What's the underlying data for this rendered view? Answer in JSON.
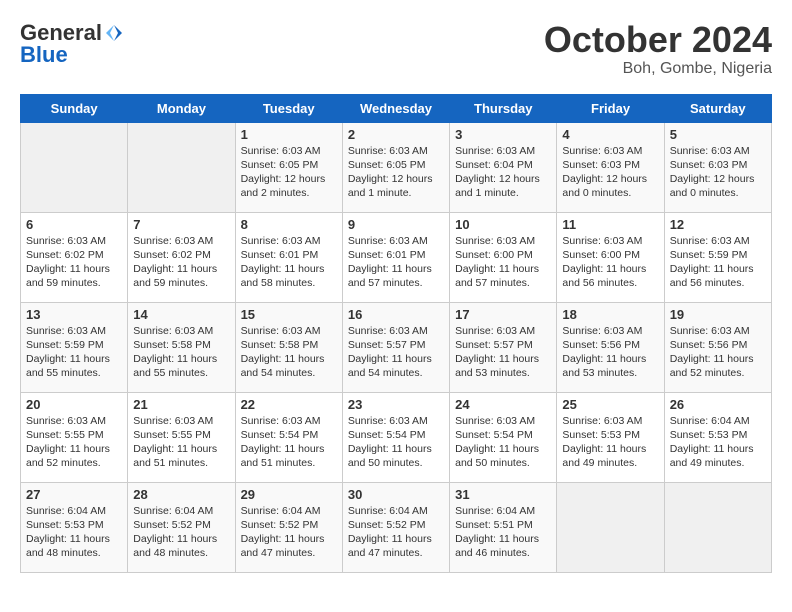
{
  "header": {
    "logo_general": "General",
    "logo_blue": "Blue",
    "month_title": "October 2024",
    "location": "Boh, Gombe, Nigeria"
  },
  "days_of_week": [
    "Sunday",
    "Monday",
    "Tuesday",
    "Wednesday",
    "Thursday",
    "Friday",
    "Saturday"
  ],
  "weeks": [
    [
      {
        "day": "",
        "empty": true
      },
      {
        "day": "",
        "empty": true
      },
      {
        "day": "1",
        "sunrise": "Sunrise: 6:03 AM",
        "sunset": "Sunset: 6:05 PM",
        "daylight": "Daylight: 12 hours and 2 minutes."
      },
      {
        "day": "2",
        "sunrise": "Sunrise: 6:03 AM",
        "sunset": "Sunset: 6:05 PM",
        "daylight": "Daylight: 12 hours and 1 minute."
      },
      {
        "day": "3",
        "sunrise": "Sunrise: 6:03 AM",
        "sunset": "Sunset: 6:04 PM",
        "daylight": "Daylight: 12 hours and 1 minute."
      },
      {
        "day": "4",
        "sunrise": "Sunrise: 6:03 AM",
        "sunset": "Sunset: 6:03 PM",
        "daylight": "Daylight: 12 hours and 0 minutes."
      },
      {
        "day": "5",
        "sunrise": "Sunrise: 6:03 AM",
        "sunset": "Sunset: 6:03 PM",
        "daylight": "Daylight: 12 hours and 0 minutes."
      }
    ],
    [
      {
        "day": "6",
        "sunrise": "Sunrise: 6:03 AM",
        "sunset": "Sunset: 6:02 PM",
        "daylight": "Daylight: 11 hours and 59 minutes."
      },
      {
        "day": "7",
        "sunrise": "Sunrise: 6:03 AM",
        "sunset": "Sunset: 6:02 PM",
        "daylight": "Daylight: 11 hours and 59 minutes."
      },
      {
        "day": "8",
        "sunrise": "Sunrise: 6:03 AM",
        "sunset": "Sunset: 6:01 PM",
        "daylight": "Daylight: 11 hours and 58 minutes."
      },
      {
        "day": "9",
        "sunrise": "Sunrise: 6:03 AM",
        "sunset": "Sunset: 6:01 PM",
        "daylight": "Daylight: 11 hours and 57 minutes."
      },
      {
        "day": "10",
        "sunrise": "Sunrise: 6:03 AM",
        "sunset": "Sunset: 6:00 PM",
        "daylight": "Daylight: 11 hours and 57 minutes."
      },
      {
        "day": "11",
        "sunrise": "Sunrise: 6:03 AM",
        "sunset": "Sunset: 6:00 PM",
        "daylight": "Daylight: 11 hours and 56 minutes."
      },
      {
        "day": "12",
        "sunrise": "Sunrise: 6:03 AM",
        "sunset": "Sunset: 5:59 PM",
        "daylight": "Daylight: 11 hours and 56 minutes."
      }
    ],
    [
      {
        "day": "13",
        "sunrise": "Sunrise: 6:03 AM",
        "sunset": "Sunset: 5:59 PM",
        "daylight": "Daylight: 11 hours and 55 minutes."
      },
      {
        "day": "14",
        "sunrise": "Sunrise: 6:03 AM",
        "sunset": "Sunset: 5:58 PM",
        "daylight": "Daylight: 11 hours and 55 minutes."
      },
      {
        "day": "15",
        "sunrise": "Sunrise: 6:03 AM",
        "sunset": "Sunset: 5:58 PM",
        "daylight": "Daylight: 11 hours and 54 minutes."
      },
      {
        "day": "16",
        "sunrise": "Sunrise: 6:03 AM",
        "sunset": "Sunset: 5:57 PM",
        "daylight": "Daylight: 11 hours and 54 minutes."
      },
      {
        "day": "17",
        "sunrise": "Sunrise: 6:03 AM",
        "sunset": "Sunset: 5:57 PM",
        "daylight": "Daylight: 11 hours and 53 minutes."
      },
      {
        "day": "18",
        "sunrise": "Sunrise: 6:03 AM",
        "sunset": "Sunset: 5:56 PM",
        "daylight": "Daylight: 11 hours and 53 minutes."
      },
      {
        "day": "19",
        "sunrise": "Sunrise: 6:03 AM",
        "sunset": "Sunset: 5:56 PM",
        "daylight": "Daylight: 11 hours and 52 minutes."
      }
    ],
    [
      {
        "day": "20",
        "sunrise": "Sunrise: 6:03 AM",
        "sunset": "Sunset: 5:55 PM",
        "daylight": "Daylight: 11 hours and 52 minutes."
      },
      {
        "day": "21",
        "sunrise": "Sunrise: 6:03 AM",
        "sunset": "Sunset: 5:55 PM",
        "daylight": "Daylight: 11 hours and 51 minutes."
      },
      {
        "day": "22",
        "sunrise": "Sunrise: 6:03 AM",
        "sunset": "Sunset: 5:54 PM",
        "daylight": "Daylight: 11 hours and 51 minutes."
      },
      {
        "day": "23",
        "sunrise": "Sunrise: 6:03 AM",
        "sunset": "Sunset: 5:54 PM",
        "daylight": "Daylight: 11 hours and 50 minutes."
      },
      {
        "day": "24",
        "sunrise": "Sunrise: 6:03 AM",
        "sunset": "Sunset: 5:54 PM",
        "daylight": "Daylight: 11 hours and 50 minutes."
      },
      {
        "day": "25",
        "sunrise": "Sunrise: 6:03 AM",
        "sunset": "Sunset: 5:53 PM",
        "daylight": "Daylight: 11 hours and 49 minutes."
      },
      {
        "day": "26",
        "sunrise": "Sunrise: 6:04 AM",
        "sunset": "Sunset: 5:53 PM",
        "daylight": "Daylight: 11 hours and 49 minutes."
      }
    ],
    [
      {
        "day": "27",
        "sunrise": "Sunrise: 6:04 AM",
        "sunset": "Sunset: 5:53 PM",
        "daylight": "Daylight: 11 hours and 48 minutes."
      },
      {
        "day": "28",
        "sunrise": "Sunrise: 6:04 AM",
        "sunset": "Sunset: 5:52 PM",
        "daylight": "Daylight: 11 hours and 48 minutes."
      },
      {
        "day": "29",
        "sunrise": "Sunrise: 6:04 AM",
        "sunset": "Sunset: 5:52 PM",
        "daylight": "Daylight: 11 hours and 47 minutes."
      },
      {
        "day": "30",
        "sunrise": "Sunrise: 6:04 AM",
        "sunset": "Sunset: 5:52 PM",
        "daylight": "Daylight: 11 hours and 47 minutes."
      },
      {
        "day": "31",
        "sunrise": "Sunrise: 6:04 AM",
        "sunset": "Sunset: 5:51 PM",
        "daylight": "Daylight: 11 hours and 46 minutes."
      },
      {
        "day": "",
        "empty": true
      },
      {
        "day": "",
        "empty": true
      }
    ]
  ]
}
